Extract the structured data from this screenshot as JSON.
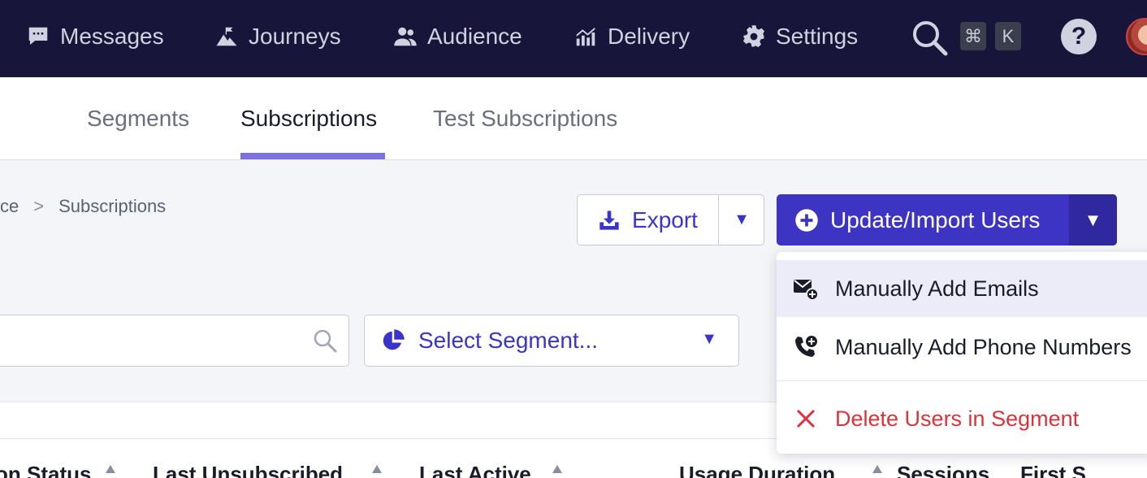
{
  "nav": {
    "messages": "Messages",
    "journeys": "Journeys",
    "audience": "Audience",
    "delivery": "Delivery",
    "settings": "Settings",
    "shortcut_cmd": "⌘",
    "shortcut_key": "K",
    "help": "?"
  },
  "tabs": {
    "segments": "Segments",
    "subscriptions": "Subscriptions",
    "test_subscriptions": "Test Subscriptions"
  },
  "breadcrumb": {
    "parent": "ce",
    "separator": ">",
    "current": "Subscriptions"
  },
  "toolbar": {
    "export_label": "Export",
    "export_caret": "▼",
    "import_label": "Update/Import Users",
    "import_caret": "▼"
  },
  "filters": {
    "search_value": "",
    "select_segment": "Select Segment...",
    "select_caret": "▼"
  },
  "dropdown": {
    "items": [
      {
        "label": "Manually Add Emails",
        "icon": "envelope-plus-icon"
      },
      {
        "label": "Manually Add Phone Numbers",
        "icon": "phone-plus-icon"
      },
      {
        "label": "Delete Users in Segment",
        "icon": "close-icon",
        "color": "#d9343c"
      }
    ]
  },
  "table": {
    "columns": [
      "on Status",
      "Last Unsubscribed",
      "Last Active",
      "Usage Duration",
      "Sessions",
      "First S"
    ]
  },
  "colors": {
    "nav_bg": "#17163a",
    "accent": "#3e34c4",
    "tab_underline": "#7b72e0",
    "danger": "#d9343c"
  }
}
